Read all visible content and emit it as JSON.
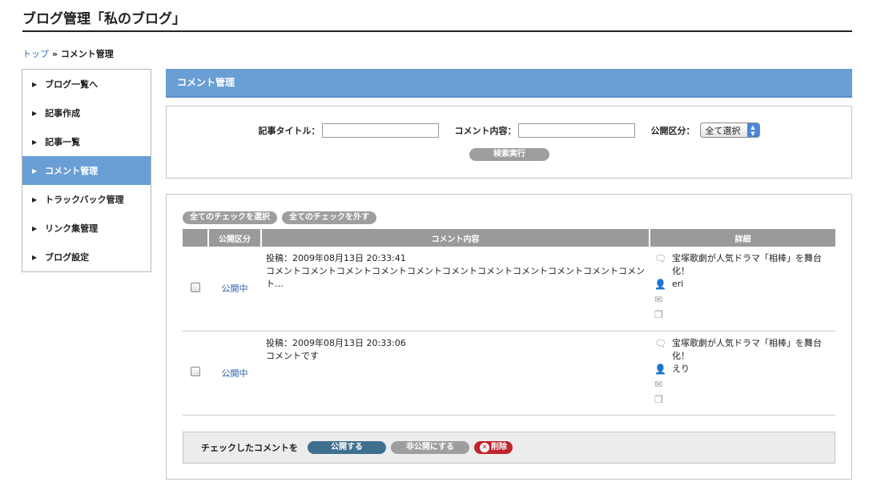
{
  "page": {
    "title": "ブログ管理「私のブログ」"
  },
  "breadcrumb": {
    "home": "トップ",
    "separator": "»",
    "current": "コメント管理"
  },
  "sidebar": {
    "items": [
      {
        "label": "ブログ一覧へ",
        "active": false
      },
      {
        "label": "記事作成",
        "active": false
      },
      {
        "label": "記事一覧",
        "active": false
      },
      {
        "label": "コメント管理",
        "active": true
      },
      {
        "label": "トラックバック管理",
        "active": false
      },
      {
        "label": "リンク集管理",
        "active": false
      },
      {
        "label": "ブログ設定",
        "active": false
      }
    ]
  },
  "main": {
    "header": "コメント管理"
  },
  "search": {
    "title_label": "記事タイトル：",
    "title_value": "",
    "content_label": "コメント内容：",
    "content_value": "",
    "status_label": "公開区分：",
    "status_selected": "全て選択",
    "submit_label": "検索実行"
  },
  "list": {
    "select_all_label": "全てのチェックを選択",
    "deselect_all_label": "全てのチェックを外す",
    "columns": [
      "",
      "公開区分",
      "コメント内容",
      "詳細"
    ],
    "rows": [
      {
        "status": "公開中",
        "posted": "投稿：2009年08月13日 20:33:41",
        "content": "コメントコメントコメントコメントコメントコメントコメントコメントコメントコメントコメント…",
        "article": "宝塚歌劇が人気ドラマ「相棒」を舞台化！",
        "author": "eri"
      },
      {
        "status": "公開中",
        "posted": "投稿：2009年08月13日 20:33:06",
        "content": "コメントです",
        "article": "宝塚歌劇が人気ドラマ「相棒」を舞台化！",
        "author": "えり"
      }
    ]
  },
  "bulk": {
    "label": "チェックしたコメントを",
    "publish_label": "公開する",
    "unpublish_label": "非公開にする",
    "delete_label": "削除"
  },
  "colors": {
    "accent": "#6a9fd6",
    "publish": "#3e6f8e",
    "delete": "#c0232b",
    "link": "#2a5da8"
  }
}
